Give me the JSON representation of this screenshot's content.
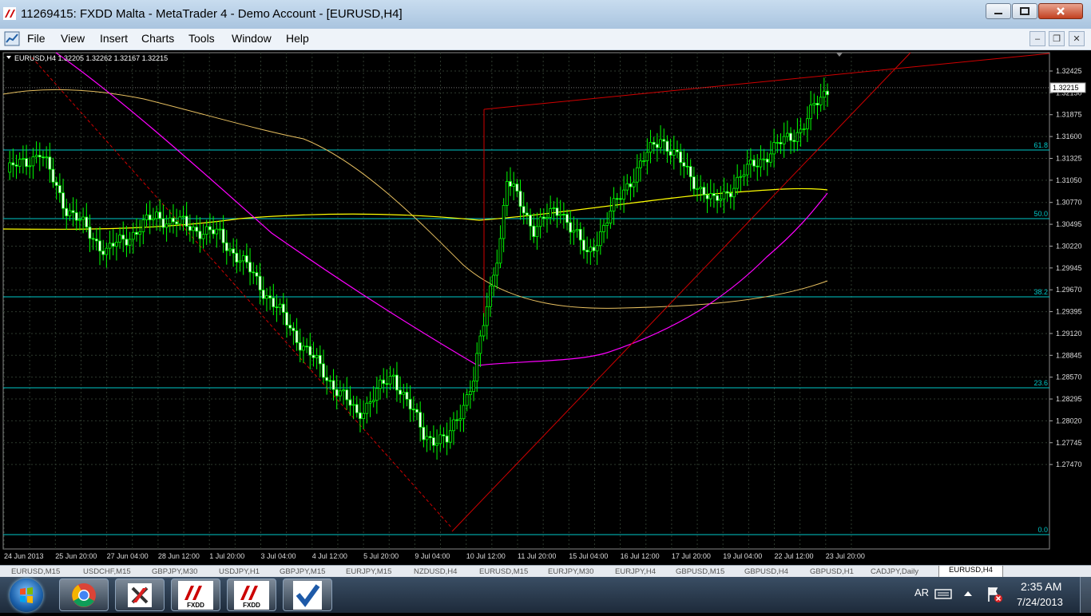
{
  "window": {
    "title": "11269415: FXDD Malta - MetaTrader 4 - Demo Account - [EURUSD,H4]"
  },
  "menu": [
    "File",
    "View",
    "Insert",
    "Charts",
    "Tools",
    "Window",
    "Help"
  ],
  "chart": {
    "header": "EURUSD,H4  1.32205 1.32262 1.32167 1.32215",
    "current_price": "1.32215",
    "price_labels": [
      "1.32425",
      "1.32150",
      "1.31875",
      "1.31600",
      "1.31325",
      "1.31050",
      "1.30770",
      "1.30495",
      "1.30220",
      "1.29945",
      "1.29670",
      "1.29395",
      "1.29120",
      "1.28845",
      "1.28570",
      "1.28295",
      "1.28020",
      "1.27745",
      "1.27470"
    ],
    "time_labels": [
      "24 Jun 2013",
      "25 Jun 20:00",
      "27 Jun 04:00",
      "28 Jun 12:00",
      "1 Jul 20:00",
      "3 Jul 04:00",
      "4 Jul 12:00",
      "5 Jul 20:00",
      "9 Jul 04:00",
      "10 Jul 12:00",
      "11 Jul 20:00",
      "15 Jul 04:00",
      "16 Jul 12:00",
      "17 Jul 20:00",
      "19 Jul 04:00",
      "22 Jul 12:00",
      "23 Jul 20:00"
    ],
    "fib_labels": [
      "61.8",
      "50.0",
      "38.2",
      "23.6",
      "0.0"
    ],
    "colors": {
      "candle": "#00ff00",
      "grid": "#2e3a2e",
      "fib": "#00c8c8",
      "ma_fast": "#ffff00",
      "ma_mid": "#ff00ff",
      "ma_slow": "#e8c060",
      "trend": "#d00000"
    }
  },
  "symbol_tabs": [
    "EURUSD,M15",
    "USDCHF,M15",
    "GBPJPY,M30",
    "USDJPY,H1",
    "GBPJPY,M15",
    "EURJPY,M15",
    "NZDUSD,H4",
    "EURUSD,M15",
    "EURJPY,M30",
    "EURJPY,H4",
    "GBPUSD,M15",
    "GBPUSD,H4",
    "GBPUSD,H1",
    "CADJPY,Daily",
    "EURUSD,H4"
  ],
  "active_tab": "EURUSD,H4",
  "taskbar": {
    "apps": [
      {
        "name": "chrome",
        "label": ""
      },
      {
        "name": "xtrade",
        "label": ""
      },
      {
        "name": "fxdd",
        "label": "FXDD"
      },
      {
        "name": "fxdd",
        "label": "FXDD"
      },
      {
        "name": "checkmark",
        "label": ""
      }
    ],
    "lang": "AR",
    "time": "2:35 AM",
    "date": "7/24/2013"
  }
}
